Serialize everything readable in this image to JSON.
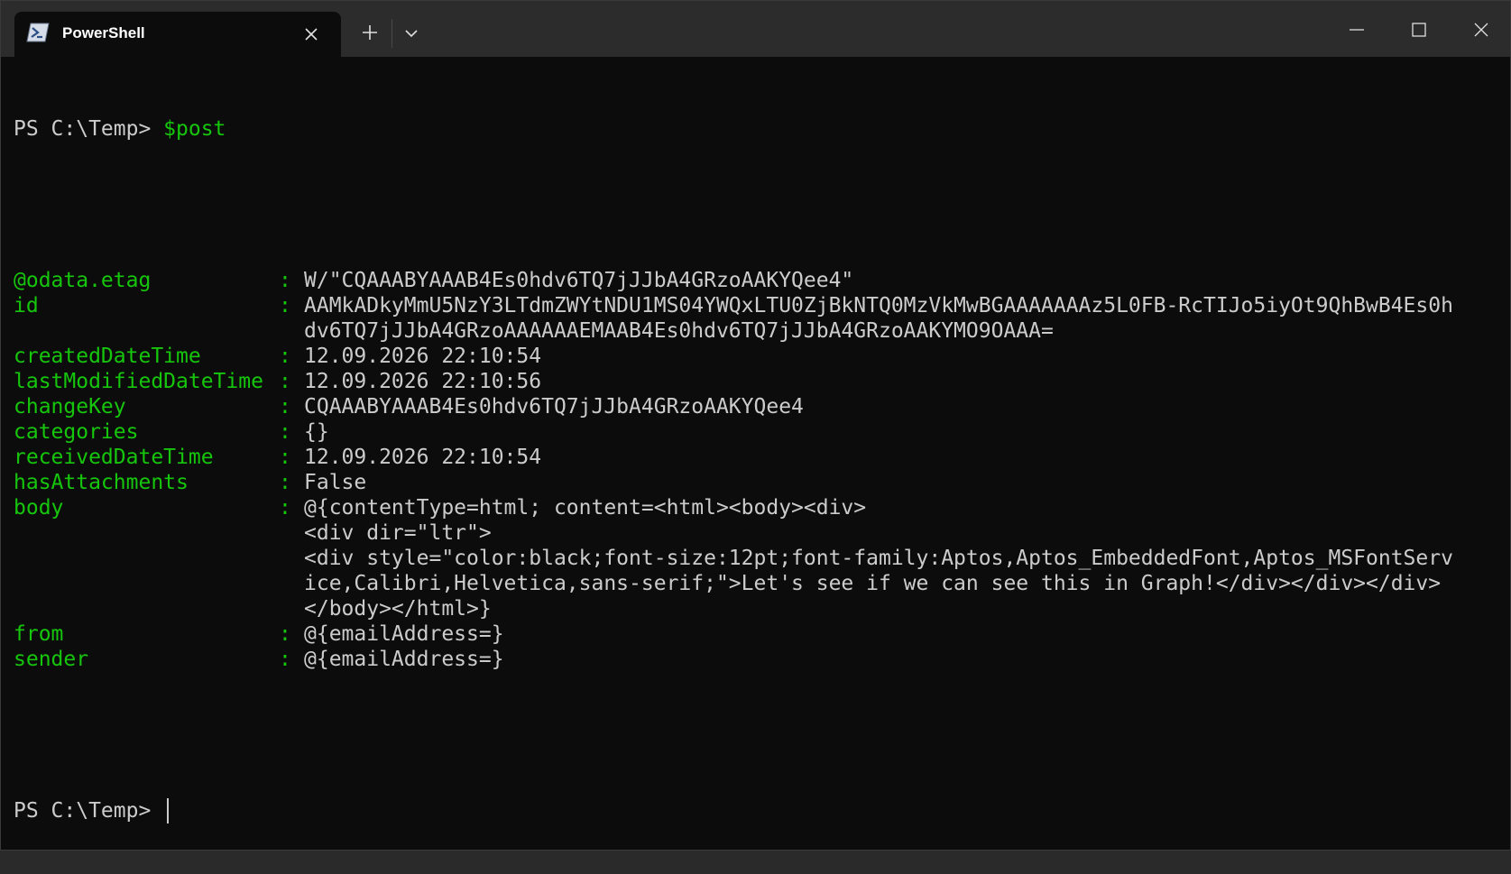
{
  "window": {
    "tab_title": "PowerShell"
  },
  "icons": {
    "tab": "powershell-icon",
    "close_tab": "close-icon",
    "new_tab": "plus-icon",
    "dropdown": "chevron-down-icon",
    "minimize": "minimize-icon",
    "maximize": "maximize-icon",
    "close_window": "close-icon"
  },
  "colors": {
    "background": "#0c0c0c",
    "titlebar": "#2c2c2c",
    "green": "#16c60c",
    "text": "#cccccc"
  },
  "terminal": {
    "prompt1": "PS C:\\Temp> ",
    "command1": "$post",
    "separator": ":",
    "props": [
      {
        "key": "@odata.etag",
        "value": "W/\"CQAAABYAAAB4Es0hdv6TQ7jJJbA4GRzoAAKYQee4\""
      },
      {
        "key": "id",
        "value": "AAMkADkyMmU5NzY3LTdmZWYtNDU1MS04YWQxLTU0ZjBkNTQ0MzVkMwBGAAAAAAAz5L0FB-RcTIJo5iyOt9QhBwB4Es0h"
      },
      {
        "key": "",
        "value": "dv6TQ7jJJbA4GRzoAAAAAAEMAAB4Es0hdv6TQ7jJJbA4GRzoAAKYMO9OAAA="
      },
      {
        "key": "createdDateTime",
        "value": "12.09.2026 22:10:54"
      },
      {
        "key": "lastModifiedDateTime",
        "value": "12.09.2026 22:10:56"
      },
      {
        "key": "changeKey",
        "value": "CQAAABYAAAB4Es0hdv6TQ7jJJbA4GRzoAAKYQee4"
      },
      {
        "key": "categories",
        "value": "{}"
      },
      {
        "key": "receivedDateTime",
        "value": "12.09.2026 22:10:54"
      },
      {
        "key": "hasAttachments",
        "value": "False"
      },
      {
        "key": "body",
        "value": "@{contentType=html; content=<html><body><div>"
      },
      {
        "key": "",
        "value": "<div dir=\"ltr\">"
      },
      {
        "key": "",
        "value": "<div style=\"color:black;font-size:12pt;font-family:Aptos,Aptos_EmbeddedFont,Aptos_MSFontServ"
      },
      {
        "key": "",
        "value": "ice,Calibri,Helvetica,sans-serif;\">Let's see if we can see this in Graph!</div></div></div>"
      },
      {
        "key": "",
        "value": "</body></html>}"
      },
      {
        "key": "from",
        "value": "@{emailAddress=}"
      },
      {
        "key": "sender",
        "value": "@{emailAddress=}"
      }
    ],
    "prompt2": "PS C:\\Temp> "
  }
}
